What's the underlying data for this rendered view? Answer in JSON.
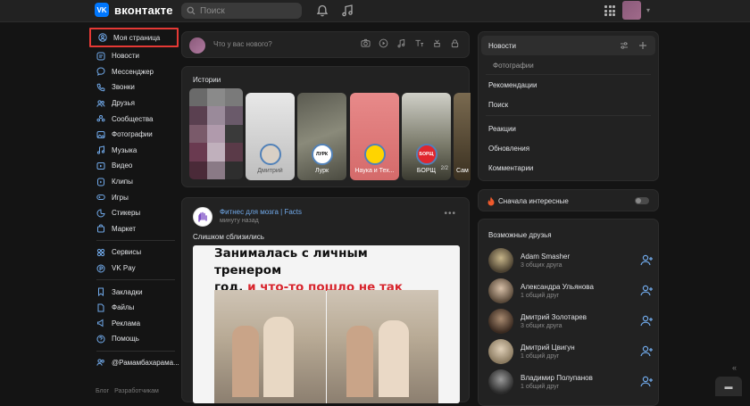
{
  "brand": {
    "name": "вконтакте",
    "mark": "VK"
  },
  "search": {
    "placeholder": "Поиск"
  },
  "sidebar": {
    "items": [
      {
        "label": "Моя страница"
      },
      {
        "label": "Новости"
      },
      {
        "label": "Мессенджер"
      },
      {
        "label": "Звонки"
      },
      {
        "label": "Друзья"
      },
      {
        "label": "Сообщества"
      },
      {
        "label": "Фотографии"
      },
      {
        "label": "Музыка"
      },
      {
        "label": "Видео"
      },
      {
        "label": "Клипы"
      },
      {
        "label": "Игры"
      },
      {
        "label": "Стикеры"
      },
      {
        "label": "Маркет"
      }
    ],
    "items2": [
      {
        "label": "Сервисы"
      },
      {
        "label": "VK Pay"
      }
    ],
    "items3": [
      {
        "label": "Закладки"
      },
      {
        "label": "Файлы"
      },
      {
        "label": "Реклама"
      },
      {
        "label": "Помощь"
      }
    ],
    "community": "@Рамамбахарама...",
    "footer": [
      "Блог",
      "Разработчикам"
    ]
  },
  "composer": {
    "placeholder": "Что у вас нового?"
  },
  "stories": {
    "title": "Истории",
    "items": [
      {
        "name": "Дмитрий",
        "ring_text": ""
      },
      {
        "name": "Лурк",
        "ring_text": "ЛУРК"
      },
      {
        "name": "Наука и Тех...",
        "ring_text": ""
      },
      {
        "name": "БОРЩ",
        "ring_text": "БОРЩ"
      },
      {
        "name": "Сам",
        "ring_text": ""
      }
    ],
    "counter": "2/2"
  },
  "post": {
    "author": "Фитнес для мозга | Facts",
    "time": "минуту назад",
    "text": "Слишком сблизились",
    "headline_black_1": "Занималась с личным тренером",
    "headline_black_2": "год, ",
    "headline_red": "и что-то пошло не так"
  },
  "right_menu": {
    "items": [
      "Новости",
      "Фотографии",
      "Рекомендации",
      "Поиск",
      "Реакции",
      "Обновления",
      "Комментарии"
    ]
  },
  "interesting": {
    "label": "Сначала интересные",
    "enabled": false
  },
  "friends": {
    "title": "Возможные друзья",
    "items": [
      {
        "name": "Adam Smasher",
        "mutual": "3 общих друга"
      },
      {
        "name": "Александра Ульянова",
        "mutual": "1 общий друг"
      },
      {
        "name": "Дмитрий Золотарев",
        "mutual": "3 общих друга"
      },
      {
        "name": "Дмитрий Цвигун",
        "mutual": "1 общий друг"
      },
      {
        "name": "Владимир Полупанов",
        "mutual": "1 общий друг"
      }
    ]
  },
  "colors": {
    "accent": "#71aaeb",
    "brand": "#0077ff",
    "highlight": "#e53935",
    "headline_red": "#d8262e"
  }
}
